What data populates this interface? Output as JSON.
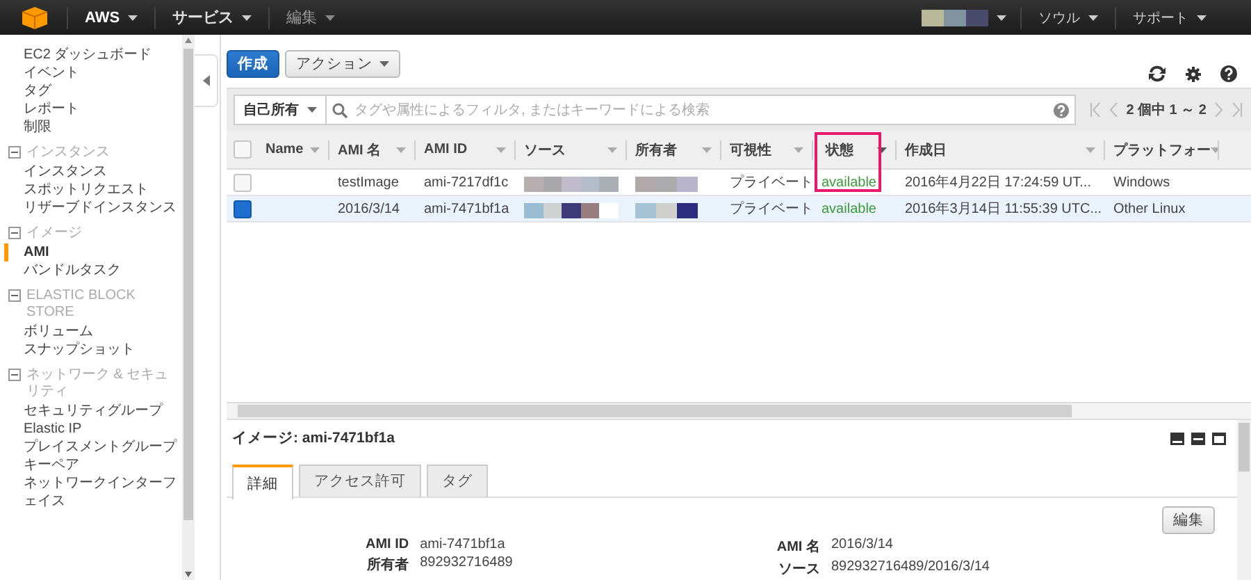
{
  "top_bar": {
    "menus": [
      {
        "label": "AWS",
        "kind": "brand"
      },
      {
        "label": "サービス",
        "kind": "menu"
      },
      {
        "label": "編集",
        "kind": "muted"
      }
    ],
    "right_menus": [
      {
        "label": "ソウル"
      },
      {
        "label": "サポート"
      }
    ]
  },
  "sidebar": {
    "sections": [
      {
        "items": [
          {
            "label": "EC2 ダッシュボード",
            "selected": false
          },
          {
            "label": "イベント",
            "selected": false
          },
          {
            "label": "タグ",
            "selected": false
          },
          {
            "label": "レポート",
            "selected": false
          },
          {
            "label": "制限",
            "selected": false
          }
        ]
      },
      {
        "title": "インスタンス",
        "expanded": true,
        "items": [
          {
            "label": "インスタンス",
            "selected": false
          },
          {
            "label": "スポットリクエスト",
            "selected": false
          },
          {
            "label": "リザーブドインスタンス",
            "selected": false
          }
        ]
      },
      {
        "title": "イメージ",
        "expanded": true,
        "items": [
          {
            "label": "AMI",
            "selected": true
          },
          {
            "label": "バンドルタスク",
            "selected": false
          }
        ]
      },
      {
        "title": "ELASTIC BLOCK STORE",
        "expanded": true,
        "items": [
          {
            "label": "ボリューム",
            "selected": false
          },
          {
            "label": "スナップショット",
            "selected": false
          }
        ]
      },
      {
        "title": "ネットワーク & セキュリティ",
        "expanded": true,
        "items": [
          {
            "label": "セキュリティグループ",
            "selected": false
          },
          {
            "label": "Elastic IP",
            "selected": false
          },
          {
            "label": "プレイスメントグループ",
            "selected": false
          },
          {
            "label": "キーペア",
            "selected": false
          },
          {
            "label": "ネットワークインターフェイス",
            "selected": false
          }
        ]
      }
    ]
  },
  "toolbar": {
    "create_button": "作成",
    "actions_button": "アクション"
  },
  "filter": {
    "scope": "自己所有",
    "placeholder": "タグや属性によるフィルタ, またはキーワードによる検索",
    "pagination": "2 個中 1 ～ 2"
  },
  "table": {
    "select_all_checked": false,
    "columns": [
      {
        "label": "Name",
        "kind": "text",
        "highlighted": false
      },
      {
        "label": "AMI 名",
        "kind": "text",
        "highlighted": false
      },
      {
        "label": "AMI ID",
        "kind": "text",
        "highlighted": false
      },
      {
        "label": "ソース",
        "kind": "redacted",
        "highlighted": false
      },
      {
        "label": "所有者",
        "kind": "redacted",
        "highlighted": false
      },
      {
        "label": "可視性",
        "kind": "text",
        "highlighted": false
      },
      {
        "label": "状態",
        "kind": "status",
        "highlighted": true
      },
      {
        "label": "作成日",
        "kind": "text",
        "highlighted": false
      },
      {
        "label": "プラットフォー",
        "kind": "text",
        "highlighted": false
      }
    ],
    "rows": [
      {
        "selected": false,
        "cells": [
          "",
          "testImage",
          "ami-7217df1c",
          "",
          "",
          "プライベート",
          "available",
          "2016年4月22日 17:24:59 UT...",
          "Windows"
        ]
      },
      {
        "selected": true,
        "cells": [
          "",
          "2016/3/14",
          "ami-7471bf1a",
          "",
          "",
          "プライベート",
          "available",
          "2016年3月14日 11:55:39 UTC...",
          "Other Linux"
        ]
      }
    ]
  },
  "detail": {
    "title": "イメージ: ami-7471bf1a",
    "tabs": [
      {
        "label": "詳細",
        "selected": true
      },
      {
        "label": "アクセス許可",
        "selected": false
      },
      {
        "label": "タグ",
        "selected": false
      }
    ],
    "edit_button": "編集",
    "left_fields": [
      {
        "label": "AMI ID",
        "value": "ami-7471bf1a"
      },
      {
        "label": "所有者",
        "value": "892932716489"
      }
    ],
    "right_fields": [
      {
        "label": "AMI 名",
        "value": "2016/3/14"
      },
      {
        "label": "ソース",
        "value": "892932716489/2016/3/14"
      }
    ]
  }
}
